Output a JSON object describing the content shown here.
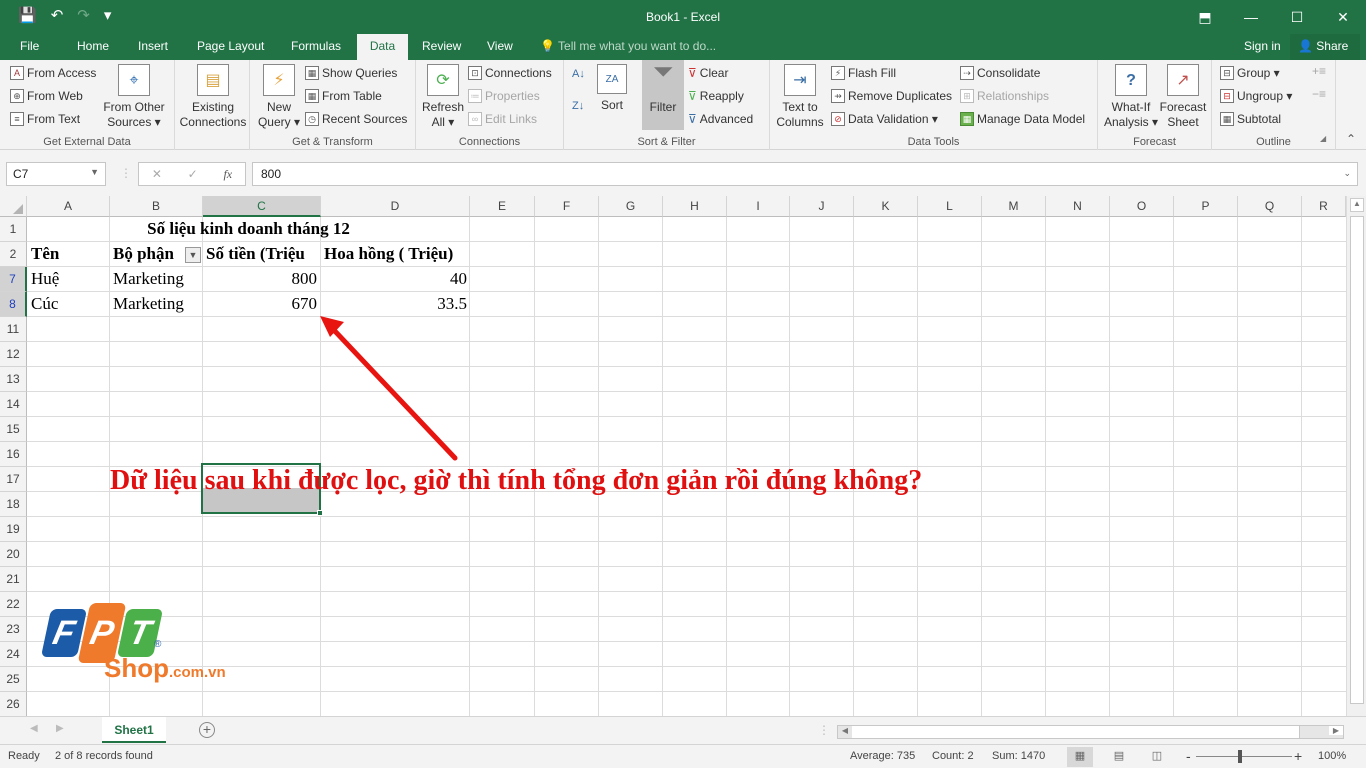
{
  "window": {
    "title": "Book1 - Excel",
    "qat": {
      "save_icon": "💾",
      "undo_icon": "↶",
      "redo_icon": "↷",
      "customize_icon": "▾"
    },
    "controls": {
      "ribbon_display": "⬒",
      "minimize": "—",
      "maximize": "☐",
      "close": "✕"
    }
  },
  "tabs": {
    "items": [
      {
        "label": "File"
      },
      {
        "label": "Home"
      },
      {
        "label": "Insert"
      },
      {
        "label": "Page Layout"
      },
      {
        "label": "Formulas"
      },
      {
        "label": "Data",
        "active": true
      },
      {
        "label": "Review"
      },
      {
        "label": "View"
      }
    ],
    "tell_me": "💡 Tell me what you want to do...",
    "sign_in": "Sign in",
    "share": "Share"
  },
  "ribbon": {
    "get_external_data": {
      "label": "Get External Data",
      "from_access": "From Access",
      "from_web": "From Web",
      "from_text": "From Text",
      "from_other_1": "From Other",
      "from_other_2": "Sources ▾",
      "existing_1": "Existing",
      "existing_2": "Connections"
    },
    "get_transform": {
      "label": "Get & Transform",
      "new_query_1": "New",
      "new_query_2": "Query ▾",
      "show_queries": "Show Queries",
      "from_table": "From Table",
      "recent_sources": "Recent Sources"
    },
    "connections": {
      "label": "Connections",
      "refresh_1": "Refresh",
      "refresh_2": "All ▾",
      "connections": "Connections",
      "properties": "Properties",
      "edit_links": "Edit Links"
    },
    "sort_filter": {
      "label": "Sort & Filter",
      "sort": "Sort",
      "filter": "Filter",
      "clear": "Clear",
      "reapply": "Reapply",
      "advanced": "Advanced"
    },
    "data_tools": {
      "label": "Data Tools",
      "text_to_1": "Text to",
      "text_to_2": "Columns",
      "flash_fill": "Flash Fill",
      "remove_duplicates": "Remove Duplicates",
      "data_validation": "Data Validation  ▾",
      "consolidate": "Consolidate",
      "relationships": "Relationships",
      "manage_data_model": "Manage Data Model"
    },
    "forecast": {
      "label": "Forecast",
      "whatif_1": "What-If",
      "whatif_2": "Analysis ▾",
      "forecast_1": "Forecast",
      "forecast_2": "Sheet"
    },
    "outline": {
      "label": "Outline",
      "group": "Group  ▾",
      "ungroup": "Ungroup  ▾",
      "subtotal": "Subtotal"
    }
  },
  "formula_bar": {
    "name_box": "C7",
    "cancel": "✕",
    "enter": "✓",
    "fx": "fx",
    "value": "800"
  },
  "columns": [
    "A",
    "B",
    "C",
    "D",
    "E",
    "F",
    "G",
    "H",
    "I",
    "J",
    "K",
    "L",
    "M",
    "N",
    "O",
    "P",
    "Q",
    "R"
  ],
  "rows": [
    "1",
    "2",
    "7",
    "8",
    "11",
    "12",
    "13",
    "14",
    "15",
    "16",
    "17",
    "18",
    "19",
    "20",
    "21",
    "22",
    "23",
    "24",
    "25",
    "26"
  ],
  "sheet": {
    "title": "Số liệu kinh doanh tháng 12",
    "headers": [
      "Tên",
      "Bộ phận",
      "Số tiền (Triệu",
      "Hoa hồng ( Triệu)"
    ],
    "filter_icon": "▼",
    "records": [
      {
        "name": "Huệ",
        "dept": "Marketing",
        "amount": "800",
        "commission": "40"
      },
      {
        "name": "Cúc",
        "dept": "Marketing",
        "amount": "670",
        "commission": "33.5"
      }
    ]
  },
  "annotation": {
    "text": "Dữ liệu sau khi được lọc, giờ thì tính tổng đơn giản rồi đúng không?",
    "color": "#e01010"
  },
  "logo": {
    "f": "F",
    "p": "P",
    "t": "T",
    "reg": "®",
    "shop": "Shop",
    "domain": ".com.vn",
    "colors": {
      "blue": "#1c5ba8",
      "orange": "#ef7a2b",
      "green": "#4bb04a"
    }
  },
  "sheet_tabs": {
    "active": "Sheet1",
    "add": "+"
  },
  "status": {
    "ready": "Ready",
    "records": "2 of 8 records found",
    "average": "Average: 735",
    "count": "Count: 2",
    "sum": "Sum: 1470",
    "zoom": "100%",
    "zoom_minus": "-",
    "zoom_plus": "+"
  },
  "colors": {
    "accent": "#217346"
  }
}
